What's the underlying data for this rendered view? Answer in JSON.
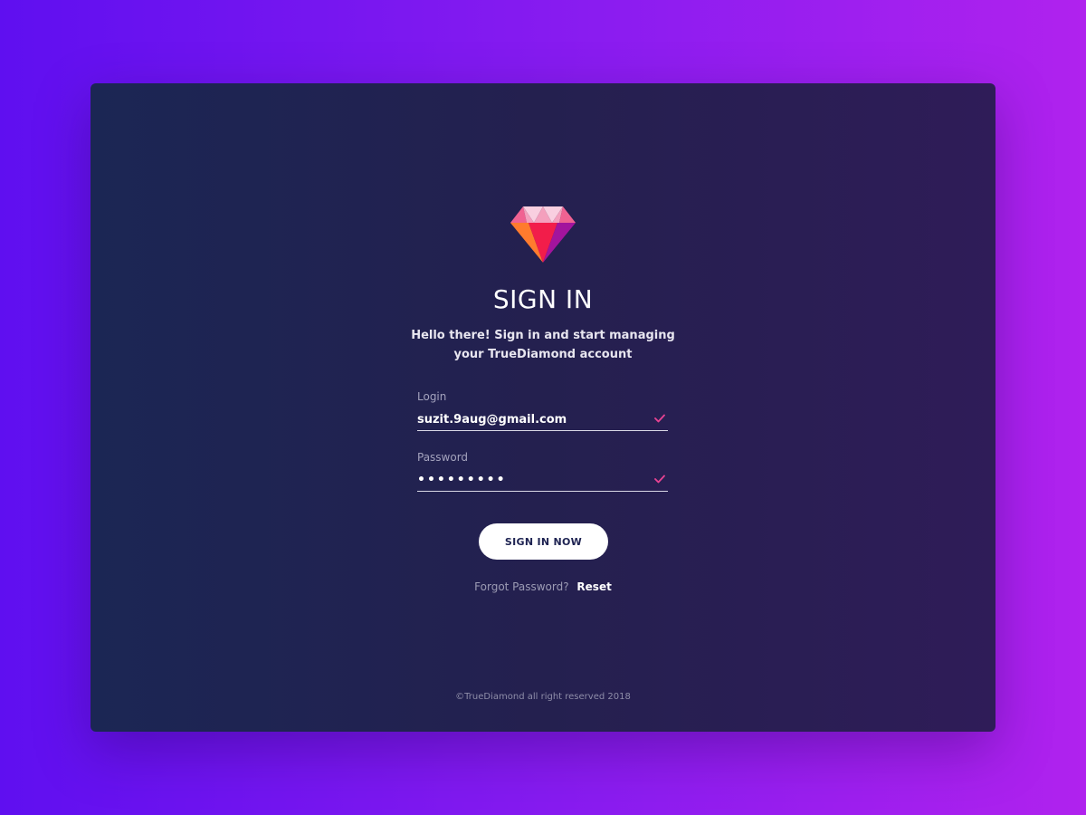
{
  "logo": {
    "icon": "diamond-icon",
    "colors": {
      "pink_light": "#f9cfe0",
      "pink": "#f06292",
      "pink_mid": "#f4a0bd",
      "orange": "#ff7b2e",
      "red": "#f21d4a",
      "purple": "#a3149d"
    }
  },
  "header": {
    "title": "SIGN IN",
    "subtitle": "Hello there! Sign in and start managing your TrueDiamond account"
  },
  "form": {
    "login": {
      "label": "Login",
      "value": "suzit.9aug@gmail.com",
      "valid_icon": "check-icon"
    },
    "password": {
      "label": "Password",
      "value": "•••••••••",
      "valid_icon": "check-icon"
    },
    "submit_label": "SIGN IN NOW"
  },
  "forgot": {
    "text": "Forgot Password?",
    "link_label": "Reset"
  },
  "footer": {
    "copyright": "©TrueDiamond all right reserved 2018"
  },
  "colors": {
    "accent": "#e84393",
    "background_start": "#5f0ff0",
    "background_end": "#b022ee",
    "card": "#24204f",
    "button": "#ffffff"
  }
}
